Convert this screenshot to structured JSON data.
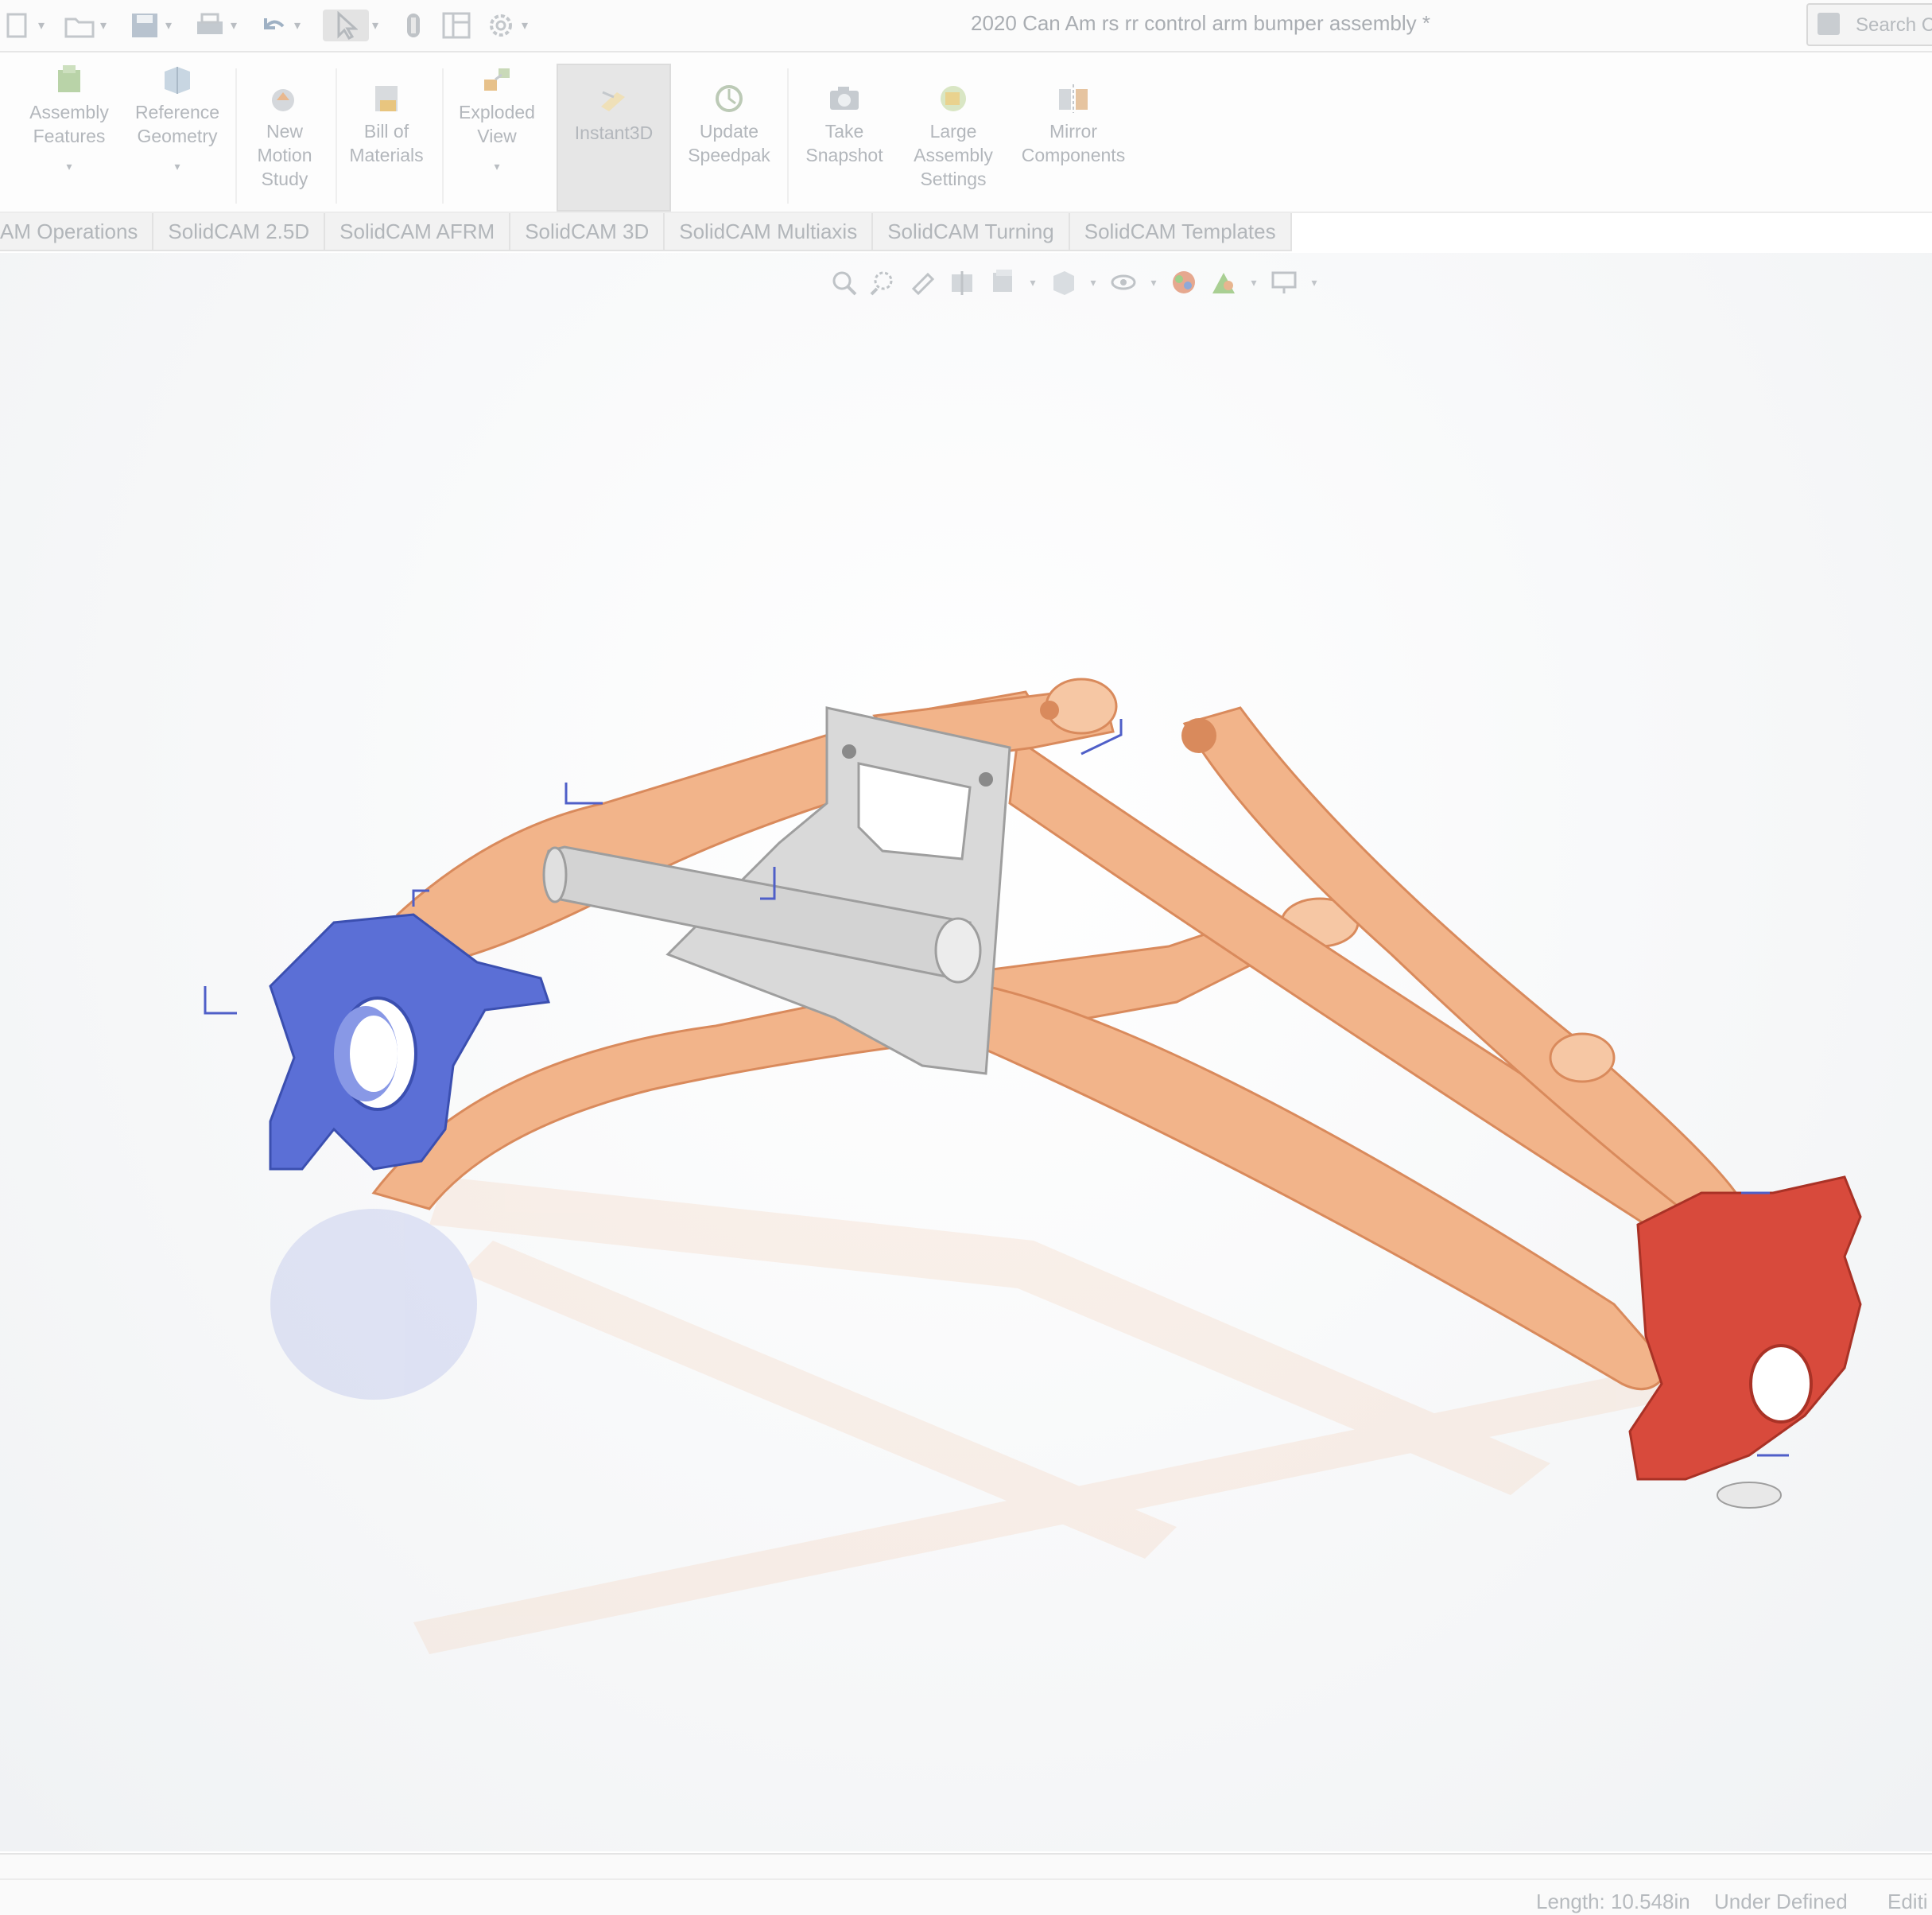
{
  "title_bar": {
    "document_title": "2020 Can Am rs rr control arm bumper assembly *",
    "search_label": "Search C"
  },
  "quick_access": [
    {
      "icon": "new-document-icon"
    },
    {
      "icon": "open-folder-icon"
    },
    {
      "icon": "save-icon"
    },
    {
      "icon": "print-icon"
    },
    {
      "icon": "undo-icon"
    },
    {
      "icon": "select-cursor-icon"
    },
    {
      "icon": "rebuild-icon"
    },
    {
      "icon": "file-properties-icon"
    },
    {
      "icon": "options-gear-icon"
    }
  ],
  "ribbon": {
    "assembly_features": "Assembly Features",
    "reference_geometry": "Reference Geometry",
    "new_motion_study": "New Motion Study",
    "bill_of_materials": "Bill of Materials",
    "exploded_view": "Exploded View",
    "instant3d": "Instant3D",
    "update_speedpak": "Update Speedpak",
    "take_snapshot": "Take Snapshot",
    "large_assembly_settings": "Large Assembly Settings",
    "mirror_components": "Mirror Components"
  },
  "command_tabs": [
    "AM Operations",
    "SolidCAM 2.5D",
    "SolidCAM AFRM",
    "SolidCAM 3D",
    "SolidCAM Multiaxis",
    "SolidCAM Turning",
    "SolidCAM Templates"
  ],
  "status_bar": {
    "length": "Length: 10.548in",
    "definition": "Under Defined",
    "mode": "Editi"
  },
  "colors": {
    "control_arm": "#f2b48a",
    "control_arm_stroke": "#d98a5c",
    "bracket": "#cfcfcf",
    "knuckle_left": "#5b6fd6",
    "knuckle_right": "#d84a3c"
  }
}
